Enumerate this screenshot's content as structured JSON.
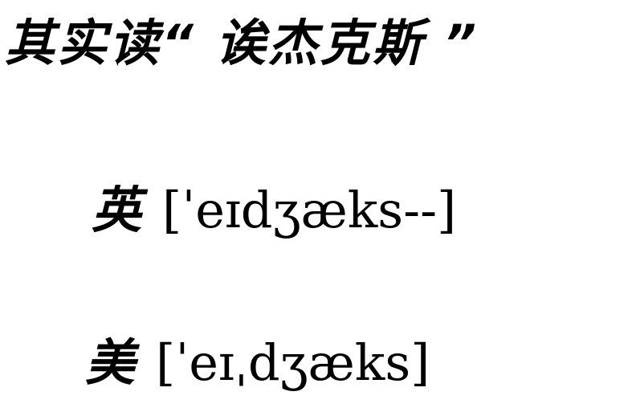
{
  "headline": "其实读“ 诶杰克斯 ”",
  "pronunciations": [
    {
      "label": "英",
      "ipa": "[ˈeɪdʒæks--]"
    },
    {
      "label": "美",
      "ipa": "[ˈeɪˌdʒæks]"
    }
  ]
}
